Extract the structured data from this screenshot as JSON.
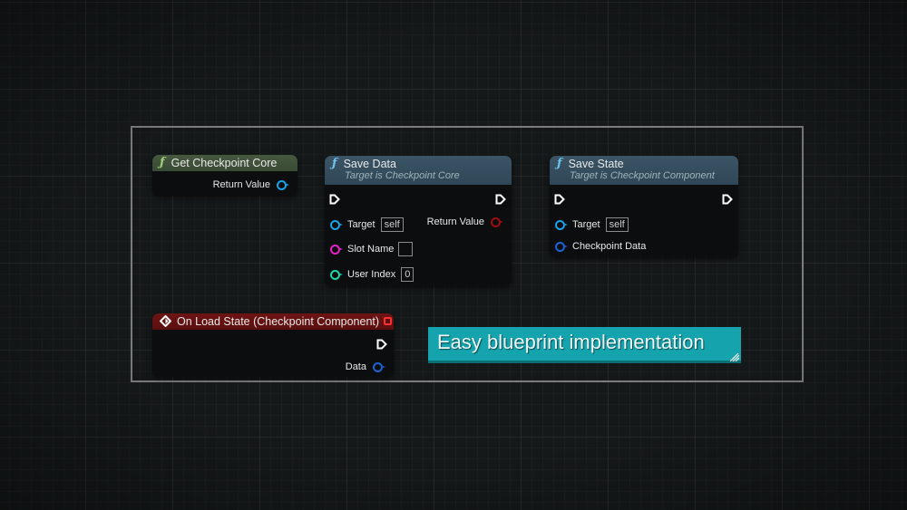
{
  "graph": {
    "nodes": {
      "get_checkpoint_core": {
        "title": "Get Checkpoint Core",
        "icon": "function-icon",
        "outputs": [
          {
            "label": "Return Value",
            "pin_color": "#1aa3e8"
          }
        ]
      },
      "save_data": {
        "title": "Save Data",
        "subtitle": "Target is Checkpoint Core",
        "icon": "function-icon",
        "inputs": [
          {
            "label": "Target",
            "value": "self",
            "pin_color": "#1aa3e8"
          },
          {
            "label": "Slot Name",
            "value": "",
            "pin_color": "#e622c8"
          },
          {
            "label": "User Index",
            "value": "0",
            "pin_color": "#1fd6a6"
          }
        ],
        "outputs": [
          {
            "label": "Return Value",
            "pin_color": "#a00d0d"
          }
        ]
      },
      "save_state": {
        "title": "Save State",
        "subtitle": "Target is Checkpoint Component",
        "icon": "function-icon",
        "inputs": [
          {
            "label": "Target",
            "value": "self",
            "pin_color": "#1aa3e8"
          },
          {
            "label": "Checkpoint Data",
            "pin_color": "#1c63d6"
          }
        ]
      },
      "on_load_state": {
        "title": "On Load State (Checkpoint Component)",
        "icon": "event-icon",
        "outputs": [
          {
            "label": "Data",
            "pin_color": "#1c63d6"
          }
        ]
      }
    },
    "comment": {
      "text": "Easy blueprint implementation",
      "color": "#15a3ad"
    }
  }
}
